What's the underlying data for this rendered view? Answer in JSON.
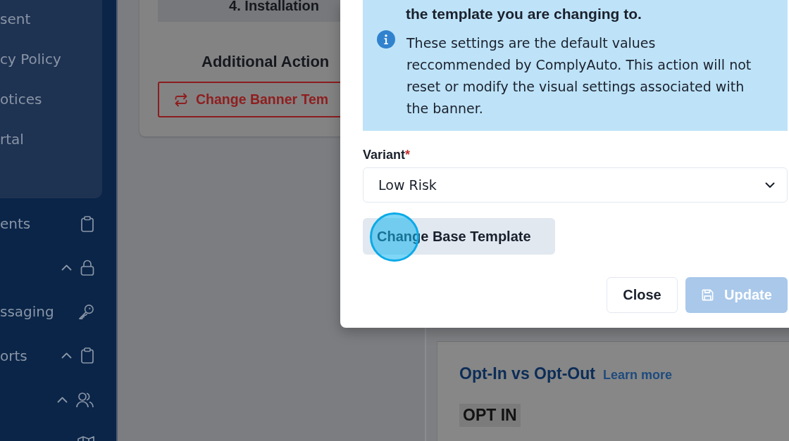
{
  "sidebar": {
    "submenu": [
      {
        "label": "sent"
      },
      {
        "label": "cy Policy"
      },
      {
        "label": "otices"
      },
      {
        "label": "rtal"
      }
    ],
    "items": [
      {
        "label": "ents",
        "expandable": false
      },
      {
        "expandable": true
      },
      {
        "label": "ssaging",
        "expandable": false
      },
      {
        "label": "orts",
        "expandable": true
      },
      {
        "expandable": true
      },
      {
        "expandable": false
      }
    ]
  },
  "page": {
    "setup_card": {
      "step": "4. Installation",
      "actions_heading": "Additional Action",
      "action_button": "Change Banner Tem"
    },
    "consent_panel": {
      "title": "Opt-In vs Opt-Out",
      "link": "Learn more",
      "tag": "OPT IN"
    }
  },
  "modal": {
    "alert": {
      "emphasis": "the template you are changing to.",
      "message": "These settings are the default values reccommended by ComplyAuto. This action will not reset or modify the visual settings associated with the banner."
    },
    "variant": {
      "label": "Variant",
      "required_mark": "*",
      "value": "Low Risk"
    },
    "change_template_button": "Change Base Template",
    "footer_buttons": [
      {
        "label": "Close",
        "kind": "secondary",
        "disabled": false
      },
      {
        "label": "Update",
        "kind": "primary",
        "disabled": true
      }
    ]
  }
}
